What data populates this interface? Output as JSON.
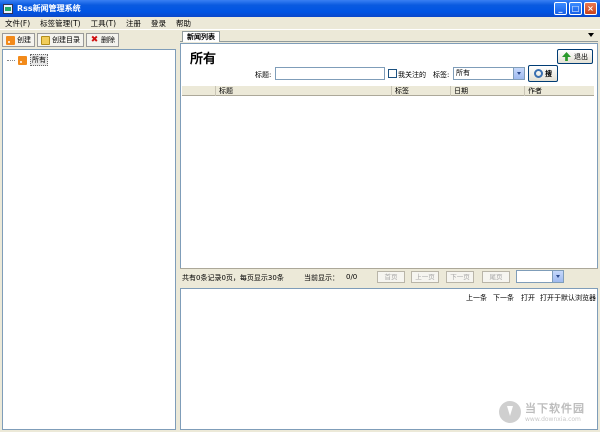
{
  "window": {
    "title": "Rss新闻管理系统",
    "controls": {
      "minimize": "_",
      "maximize": "□",
      "close": "×"
    }
  },
  "menu": [
    "文件(F)",
    "标签管理(T)",
    "工具(T)",
    "注册",
    "登录",
    "帮助"
  ],
  "left_toolbar": {
    "create": "创建",
    "create_dir": "创建目录",
    "delete": "删除"
  },
  "tree": {
    "root_label": "所有"
  },
  "tabs": [
    {
      "label": "新闻列表",
      "active": true
    }
  ],
  "list_panel": {
    "title": "所有",
    "exit_label": "退出",
    "filter": {
      "title_label": "标题:",
      "title_value": "",
      "follow_label": "我关注的",
      "follow_checked": false,
      "tag_label": "标签:",
      "tag_selected": "所有",
      "search_label": "搜"
    },
    "columns": [
      "标题",
      "标签",
      "日期",
      "作者"
    ]
  },
  "pager": {
    "summary": "共有0条记录0页，每页显示30条",
    "current_label": "当前显示：",
    "current_value": "0/0",
    "first": "首页",
    "prev": "上一页",
    "next": "下一页",
    "last": "尾页",
    "page_select": ""
  },
  "detail": {
    "prev_item": "上一条",
    "next_item": "下一条",
    "open": "打开",
    "open_browser": "打开于默认浏览器"
  },
  "watermark": {
    "main": "当下软件园",
    "sub": "www.downxia.com"
  }
}
